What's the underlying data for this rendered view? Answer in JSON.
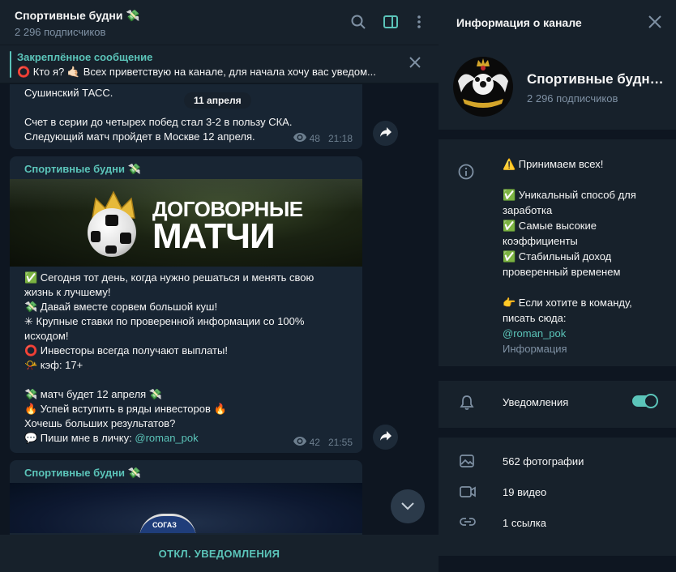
{
  "chat": {
    "title": "Спортивные будни 💸",
    "subscribers": "2 296 подписчиков"
  },
  "pinned": {
    "title": "Закреплённое сообщение",
    "text": "⭕ Кто я? 🤙🏻 Всех приветствую на канале, для начала хочу вас уведом..."
  },
  "messages": [
    {
      "lines": [
        "Сушинский ТАСС.",
        "",
        "Счет в серии до четырех побед стал 3-2 в пользу СКА.",
        "Следующий матч пройдет в Москве 12 апреля."
      ],
      "views": "48",
      "time": "21:18"
    },
    {
      "author": "Спортивные будни 💸",
      "banner_line1": "ДОГОВОРНЫЕ",
      "banner_line2": "МАТЧИ",
      "lines": [
        "✅ Сегодня тот день, когда нужно решаться и менять свою",
        "жизнь к лучшему!",
        "💸 Давай вместе сорвем большой куш!",
        "✳ Крупные ставки по проверенной информации со 100%",
        "исходом!",
        "⭕ Инвесторы всегда получают выплаты!",
        "📯 кэф: 17+",
        "",
        "💸 матч будет 12 апреля 💸",
        "🔥 Успей вступить в ряды инвесторов 🔥",
        "Хочешь больших результатов?"
      ],
      "last_line_prefix": "💬 Пиши мне в личку: ",
      "last_line_link": "@roman_pok",
      "views": "42",
      "time": "21:55"
    },
    {
      "author": "Спортивные будни 💸",
      "banner_text": "СОГАЗ"
    }
  ],
  "date_pill": "11 апреля",
  "bottom_bar": "ОТКЛ. УВЕДОМЛЕНИЯ",
  "info_panel": {
    "title": "Информация о канале",
    "name": "Спортивные будни 💸",
    "subscribers": "2 296 подписчиков",
    "description": [
      "⚠️ Принимаем всех!",
      "",
      "✅ Уникальный способ для заработка",
      "✅ Самые высокие коэффициенты",
      "✅ Стабильный доход проверенный временем",
      "",
      "👉 Если хотите в команду, писать сюда:"
    ],
    "contact_link": "@roman_pok",
    "info_label": "Информация",
    "notifications_label": "Уведомления",
    "notifications_on": true,
    "media": [
      {
        "icon": "photo-icon",
        "label": "562 фотографии"
      },
      {
        "icon": "video-icon",
        "label": "19 видео"
      },
      {
        "icon": "link-icon",
        "label": "1 ссылка"
      }
    ]
  },
  "colors": {
    "accent": "#5bc4b9",
    "bg": "#0e1621",
    "panel": "#17212b",
    "bubble": "#182533",
    "muted": "#7f91a4"
  }
}
